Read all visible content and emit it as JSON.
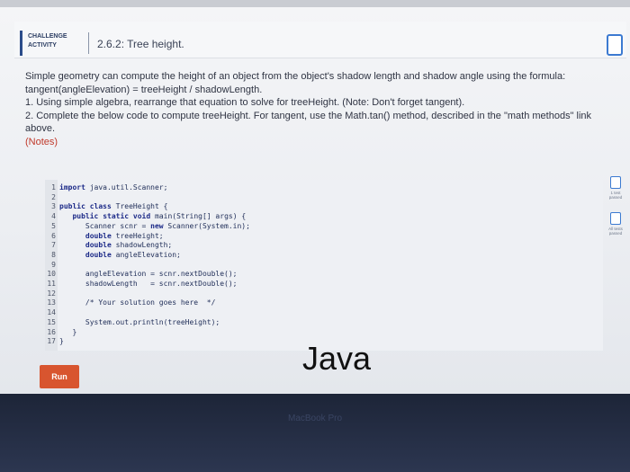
{
  "header": {
    "badge_line1": "CHALLENGE",
    "badge_line2": "ACTIVITY",
    "title": "2.6.2: Tree height."
  },
  "description": {
    "p1": "Simple geometry can compute the height of an object from the object's shadow length and shadow angle using the formula:",
    "p2": "tangent(angleElevation) = treeHeight / shadowLength.",
    "p3": "1. Using simple algebra, rearrange that equation to solve for treeHeight. (Note: Don't forget tangent).",
    "p4": "2. Complete the below code to compute treeHeight. For tangent, use the Math.tan() method, described in the \"math methods\" link",
    "p5": "above.",
    "notes": "(Notes)"
  },
  "code": {
    "lines": [
      {
        "n": "1",
        "t": "import java.util.Scanner;"
      },
      {
        "n": "2",
        "t": ""
      },
      {
        "n": "3",
        "t": "public class TreeHeight {"
      },
      {
        "n": "4",
        "t": "   public static void main(String[] args) {"
      },
      {
        "n": "5",
        "t": "      Scanner scnr = new Scanner(System.in);"
      },
      {
        "n": "6",
        "t": "      double treeHeight;"
      },
      {
        "n": "7",
        "t": "      double shadowLength;"
      },
      {
        "n": "8",
        "t": "      double angleElevation;"
      },
      {
        "n": "9",
        "t": ""
      },
      {
        "n": "10",
        "t": "      angleElevation = scnr.nextDouble();"
      },
      {
        "n": "11",
        "t": "      shadowLength   = scnr.nextDouble();"
      },
      {
        "n": "12",
        "t": ""
      },
      {
        "n": "13",
        "t": "      /* Your solution goes here  */"
      },
      {
        "n": "14",
        "t": ""
      },
      {
        "n": "15",
        "t": "      System.out.println(treeHeight);"
      },
      {
        "n": "16",
        "t": "   }"
      },
      {
        "n": "17",
        "t": "}"
      }
    ]
  },
  "tests": {
    "test1": "1 test passed",
    "test2": "All tests passed"
  },
  "run_label": "Run",
  "overlay_text": "Java",
  "bezel_label": "MacBook Pro",
  "colors": {
    "accent": "#3c7ad1",
    "run": "#d8552f",
    "notes": "#c0392b"
  }
}
